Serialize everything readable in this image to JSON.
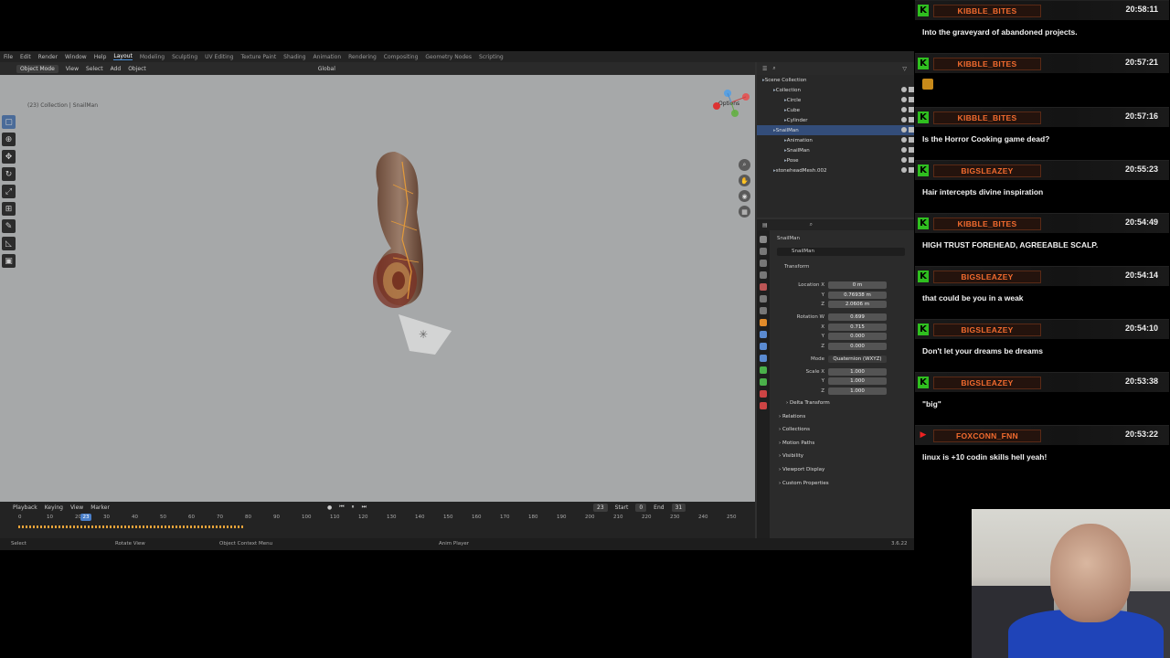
{
  "blender": {
    "top_menu": [
      "File",
      "Edit",
      "Render",
      "Window",
      "Help"
    ],
    "workspaces": [
      "Layout",
      "Modeling",
      "Sculpting",
      "UV Editing",
      "Texture Paint",
      "Shading",
      "Animation",
      "Rendering",
      "Compositing",
      "Geometry Nodes",
      "Scripting"
    ],
    "active_workspace": "Layout",
    "viewport_header": {
      "mode": "Object Mode",
      "menus": [
        "View",
        "Select",
        "Add",
        "Object"
      ],
      "orientation": "Global",
      "options": "Options"
    },
    "viewport_info": "(23) Collection | SnailMan",
    "outliner": {
      "rows": [
        {
          "label": "Scene Collection",
          "indent": 0,
          "selected": false
        },
        {
          "label": "Collection",
          "indent": 1,
          "selected": false
        },
        {
          "label": "Circle",
          "indent": 2,
          "selected": false
        },
        {
          "label": "Cube",
          "indent": 2,
          "selected": false
        },
        {
          "label": "Cylinder",
          "indent": 2,
          "selected": false
        },
        {
          "label": "SnailMan",
          "indent": 1,
          "selected": true
        },
        {
          "label": "Animation",
          "indent": 2,
          "selected": false
        },
        {
          "label": "SnailMan",
          "indent": 2,
          "selected": false
        },
        {
          "label": "Pose",
          "indent": 2,
          "selected": false
        },
        {
          "label": "stoneheadMesh.002",
          "indent": 1,
          "selected": false
        }
      ]
    },
    "properties": {
      "object_name": "SnailMan",
      "object_field": "SnailMan",
      "transform_label": "Transform",
      "fields": [
        {
          "label": "Location X",
          "value": "0 m"
        },
        {
          "label": "Y",
          "value": "0.76938 m"
        },
        {
          "label": "Z",
          "value": "2.0606 m"
        },
        {
          "label": "Rotation W",
          "value": "0.699"
        },
        {
          "label": "X",
          "value": "0.715"
        },
        {
          "label": "Y",
          "value": "0.000"
        },
        {
          "label": "Z",
          "value": "0.000"
        },
        {
          "label": "Mode",
          "value": "Quaternion (WXYZ)"
        },
        {
          "label": "Scale X",
          "value": "1.000"
        },
        {
          "label": "Y",
          "value": "1.000"
        },
        {
          "label": "Z",
          "value": "1.000"
        }
      ],
      "sections": [
        "Delta Transform",
        "Relations",
        "Collections",
        "Motion Paths",
        "Visibility",
        "Viewport Display",
        "Custom Properties"
      ]
    },
    "timeline": {
      "menus": [
        "Playback",
        "Keying",
        "View",
        "Marker"
      ],
      "current_frame": "23",
      "start_label": "Start",
      "start": "0",
      "end_label": "End",
      "end": "31",
      "ticks": [
        "0",
        "10",
        "20",
        "30",
        "40",
        "50",
        "60",
        "70",
        "80",
        "90",
        "100",
        "110",
        "120",
        "130",
        "140",
        "150",
        "160",
        "170",
        "180",
        "190",
        "200",
        "210",
        "220",
        "230",
        "240",
        "250"
      ]
    },
    "statusbar": {
      "select": "Select",
      "rotate": "Rotate View",
      "context": "Object Context Menu",
      "anim": "Anim Player",
      "version": "3.6.22"
    }
  },
  "chat": [
    {
      "platform": "kick",
      "user": "KIBBLE_BITES",
      "time": "20:58:11",
      "text": "Into the graveyard of abandoned projects."
    },
    {
      "platform": "kick",
      "user": "KIBBLE_BITES",
      "time": "20:57:21",
      "text": "",
      "emoji": true
    },
    {
      "platform": "kick",
      "user": "KIBBLE_BITES",
      "time": "20:57:16",
      "text": "Is the Horror Cooking game dead?"
    },
    {
      "platform": "kick",
      "user": "BIGSLEAZEY",
      "time": "20:55:23",
      "text": "Hair intercepts divine inspiration"
    },
    {
      "platform": "kick",
      "user": "KIBBLE_BITES",
      "time": "20:54:49",
      "text": "HIGH TRUST FOREHEAD, AGREEABLE SCALP."
    },
    {
      "platform": "kick",
      "user": "BIGSLEAZEY",
      "time": "20:54:14",
      "text": "that could be you in a weak"
    },
    {
      "platform": "kick",
      "user": "BIGSLEAZEY",
      "time": "20:54:10",
      "text": "Don't let your dreams be dreams"
    },
    {
      "platform": "kick",
      "user": "BIGSLEAZEY",
      "time": "20:53:38",
      "text": "\"big\""
    },
    {
      "platform": "youtube",
      "user": "FOXCONN_FNN",
      "time": "20:53:22",
      "text": "linux is +10 codin skills hell yeah!"
    }
  ]
}
